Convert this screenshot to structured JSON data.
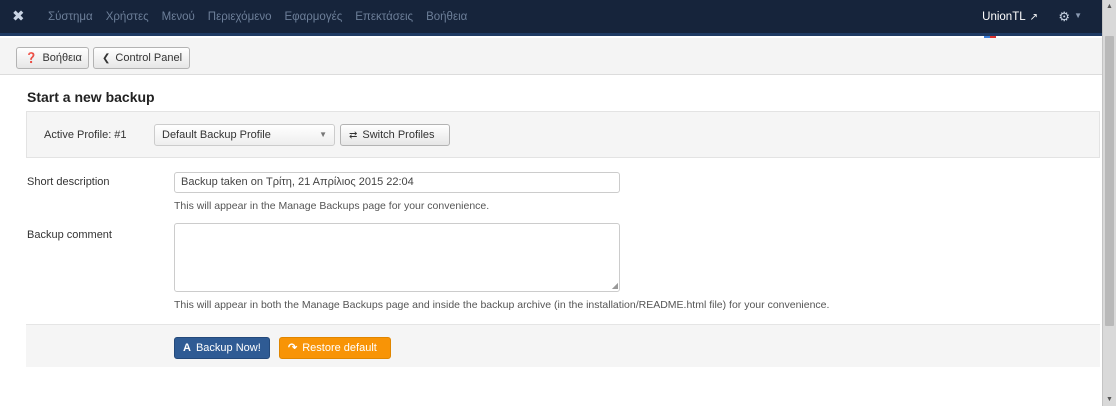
{
  "navbar": {
    "menu": [
      "Σύστημα",
      "Χρήστες",
      "Μενού",
      "Περιεχόμενο",
      "Εφαρμογές",
      "Επεκτάσεις",
      "Βοήθεια"
    ],
    "site_name": "UnionTL"
  },
  "toolbar": {
    "help_label": "Βοήθεια",
    "control_panel_label": "Control Panel"
  },
  "main": {
    "title": "Start a new backup",
    "profile": {
      "label": "Active Profile: #1",
      "selected": "Default Backup Profile",
      "switch_label": "Switch Profiles"
    },
    "short_description": {
      "label": "Short description",
      "value": "Backup taken on Τρίτη, 21 Απρίλιος 2015 22:04",
      "help": "This will appear in the Manage Backups page for your convenience."
    },
    "backup_comment": {
      "label": "Backup comment",
      "value": "",
      "help": "This will appear in both the Manage Backups page and inside the backup archive (in the installation/README.html file) for your convenience."
    },
    "actions": {
      "backup_now": "Backup Now!",
      "restore_default": "Restore default"
    }
  },
  "colors": {
    "navbar_bg": "#16243b",
    "primary_button": "#2f5b94",
    "warning_button": "#f89406"
  },
  "icons": [
    "joomla-logo-icon",
    "external-link-icon",
    "gear-icon",
    "help-circle-icon",
    "chevron-left-icon",
    "switch-icon",
    "backup-icon",
    "restore-icon"
  ]
}
